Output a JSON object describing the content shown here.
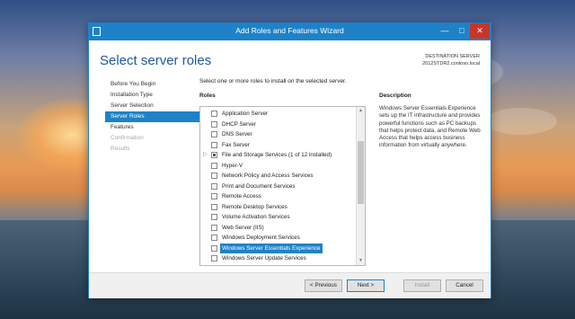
{
  "window": {
    "title": "Add Roles and Features Wizard",
    "controls": {
      "minimize": "—",
      "maximize": "□",
      "close": "✕"
    }
  },
  "header": {
    "title": "Select server roles",
    "destination_label": "DESTINATION SERVER",
    "destination_server": "2012STDR2.contoso.local"
  },
  "nav": {
    "items": [
      {
        "label": "Before You Begin",
        "state": "normal"
      },
      {
        "label": "Installation Type",
        "state": "normal"
      },
      {
        "label": "Server Selection",
        "state": "normal"
      },
      {
        "label": "Server Roles",
        "state": "active"
      },
      {
        "label": "Features",
        "state": "normal"
      },
      {
        "label": "Confirmation",
        "state": "disabled"
      },
      {
        "label": "Results",
        "state": "disabled"
      }
    ]
  },
  "main": {
    "intro": "Select one or more roles to install on the selected server.",
    "roles_heading": "Roles",
    "description_heading": "Description",
    "description": "Windows Server Essentials Experience sets up the IT infrastructure and provides powerful functions such as PC backups that helps protect data, and Remote Web Access that helps access business information from virtually anywhere.",
    "roles": [
      {
        "label": "Application Server",
        "checked": false
      },
      {
        "label": "DHCP Server",
        "checked": false
      },
      {
        "label": "DNS Server",
        "checked": false
      },
      {
        "label": "Fax Server",
        "checked": false
      },
      {
        "label": "File and Storage Services (1 of 12 installed)",
        "checked": "partial",
        "expandable": true
      },
      {
        "label": "Hyper-V",
        "checked": false
      },
      {
        "label": "Network Policy and Access Services",
        "checked": false
      },
      {
        "label": "Print and Document Services",
        "checked": false
      },
      {
        "label": "Remote Access",
        "checked": false
      },
      {
        "label": "Remote Desktop Services",
        "checked": false
      },
      {
        "label": "Volume Activation Services",
        "checked": false
      },
      {
        "label": "Web Server (IIS)",
        "checked": false
      },
      {
        "label": "Windows Deployment Services",
        "checked": false
      },
      {
        "label": "Windows Server Essentials Experience",
        "checked": false,
        "selected": true
      },
      {
        "label": "Windows Server Update Services",
        "checked": false
      }
    ]
  },
  "footer": {
    "previous": "< Previous",
    "next": "Next >",
    "install": "Install",
    "cancel": "Cancel"
  },
  "colors": {
    "accent": "#1e82c8",
    "title_text": "#1e5aa0",
    "close": "#c7352a"
  }
}
